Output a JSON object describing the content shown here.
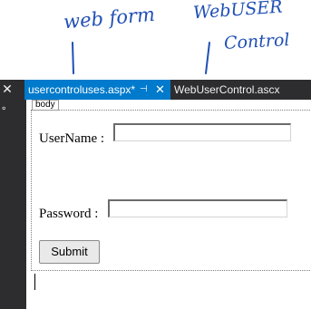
{
  "annotations": {
    "webform": "web form",
    "usercontrol_line1": "WebUSER",
    "usercontrol_line2": "Control"
  },
  "tabs": [
    {
      "label": "usercontroluses.aspx*",
      "active": true
    },
    {
      "label": "WebUserControl.ascx",
      "active": false
    }
  ],
  "icons": {
    "pin": "pin-icon",
    "close": "close-icon"
  },
  "design": {
    "body_tag": "body",
    "username_label": "UserName  :",
    "password_label": "Password :",
    "username_value": "",
    "password_value": "",
    "submit_label": "Submit"
  },
  "colors": {
    "ide_dark": "#2d2d30",
    "tab_active": "#007acc",
    "annotation_ink": "#1f4fb5"
  }
}
